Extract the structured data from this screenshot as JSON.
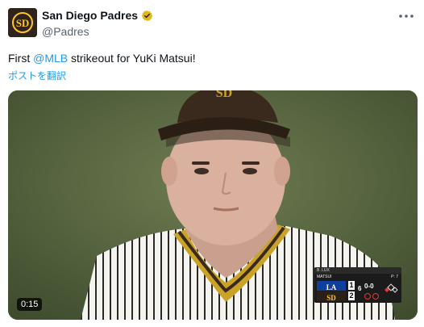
{
  "header": {
    "display_name": "San Diego Padres",
    "handle": "@Padres",
    "verified": true,
    "avatar_icon": "padres-sd-logo",
    "more_icon": "more-horizontal-icon"
  },
  "tweet": {
    "text_before": "First ",
    "mention": "@MLB",
    "text_after": " strikeout for YuKi Matsui!",
    "translate_label": "ポストを翻訳"
  },
  "media": {
    "duration": "0:15",
    "scorebug": {
      "pitcher_top": "B. LUX",
      "pitcher_name": "MATSUI",
      "pitch_count": "P: 7",
      "away_score": "1",
      "home_score": "2",
      "inning": "6",
      "count": "0-0"
    }
  },
  "colors": {
    "link": "#1d9bf0",
    "handle": "#536471",
    "verified": "#e2b719",
    "padres_brown": "#2f241d",
    "padres_gold": "#ffc425"
  }
}
